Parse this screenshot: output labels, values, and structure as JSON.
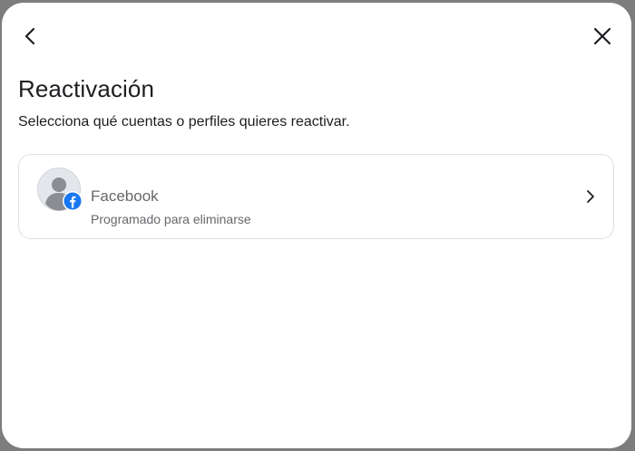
{
  "dialog": {
    "title": "Reactivación",
    "subtitle": "Selecciona qué cuentas o perfiles quieres reactivar."
  },
  "nav": {
    "back_icon": "chevron-left-icon",
    "close_icon": "close-icon"
  },
  "accounts": [
    {
      "name": "Facebook",
      "status": "Programado para eliminarse",
      "avatar_icon": "default-avatar-icon",
      "badge_icon": "facebook-icon",
      "badge_color": "#1877f2",
      "action_icon": "chevron-right-icon"
    }
  ],
  "colors": {
    "text_primary": "#1c1e21",
    "text_secondary": "#65676b",
    "card_border": "#dde1e5",
    "facebook_blue": "#1877f2"
  }
}
